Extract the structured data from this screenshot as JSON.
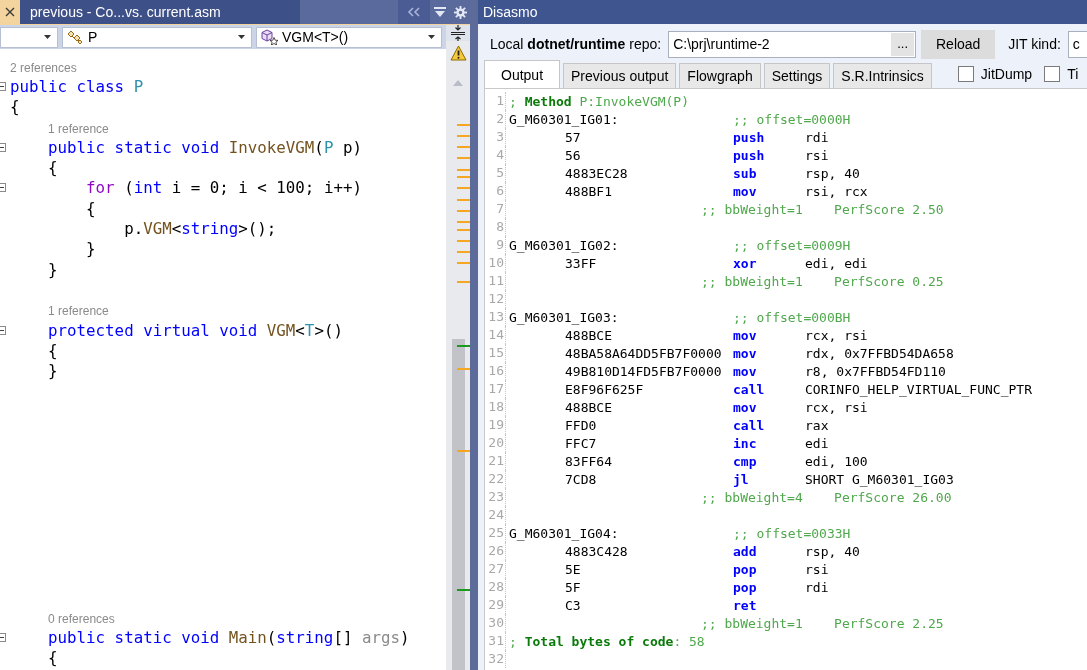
{
  "ide_tab": {
    "title": "previous - Co...vs. current.asm"
  },
  "navigation_bar": {
    "dropdowns": [
      {
        "kind": "empty"
      },
      {
        "kind": "class",
        "text": "P"
      },
      {
        "kind": "method",
        "text": "VGM<T>()"
      }
    ]
  },
  "editor": {
    "sections": [
      {
        "lines": [
          {
            "kind": "refs",
            "text": "2 references"
          },
          {
            "kind": "code",
            "fold": true,
            "tokens": [
              {
                "t": "public class ",
                "kind": "kw"
              },
              {
                "t": "P",
                "kind": "type"
              }
            ]
          },
          {
            "kind": "code",
            "fold": false,
            "tokens": [
              {
                "t": "{",
                "kind": "plain"
              }
            ]
          },
          {
            "kind": "refs",
            "text": "1 reference"
          },
          {
            "kind": "code",
            "fold": true,
            "tokens": [
              {
                "t": "    public static void ",
                "kind": "kw"
              },
              {
                "t": "InvokeVGM",
                "kind": "method"
              },
              {
                "t": "(",
                "kind": "plain"
              },
              {
                "t": "P",
                "kind": "type"
              },
              {
                "t": " p)",
                "kind": "plain"
              }
            ]
          },
          {
            "kind": "code",
            "fold": false,
            "tokens": [
              {
                "t": "    {",
                "kind": "plain"
              }
            ]
          },
          {
            "kind": "code",
            "fold": true,
            "tokens": [
              {
                "t": "        for",
                "kind": "ctrl"
              },
              {
                "t": " (",
                "kind": "plain"
              },
              {
                "t": "int",
                "kind": "kw"
              },
              {
                "t": " i = 0; i < 100; i++)",
                "kind": "plain"
              }
            ]
          },
          {
            "kind": "code",
            "fold": false,
            "tokens": [
              {
                "t": "        {",
                "kind": "plain"
              }
            ]
          },
          {
            "kind": "code",
            "fold": false,
            "tokens": [
              {
                "t": "            p.",
                "kind": "plain"
              },
              {
                "t": "VGM",
                "kind": "method"
              },
              {
                "t": "<",
                "kind": "plain"
              },
              {
                "t": "string",
                "kind": "kw"
              },
              {
                "t": ">();",
                "kind": "plain"
              }
            ]
          },
          {
            "kind": "code",
            "fold": false,
            "tokens": [
              {
                "t": "        }",
                "kind": "plain"
              }
            ]
          },
          {
            "kind": "code",
            "fold": false,
            "tokens": [
              {
                "t": "    }",
                "kind": "plain"
              }
            ]
          },
          {
            "kind": "blank"
          },
          {
            "kind": "refs",
            "text": "1 reference"
          },
          {
            "kind": "code",
            "fold": true,
            "tokens": [
              {
                "t": "    protected virtual void ",
                "kind": "kw"
              },
              {
                "t": "VGM",
                "kind": "method"
              },
              {
                "t": "<",
                "kind": "plain"
              },
              {
                "t": "T",
                "kind": "type"
              },
              {
                "t": ">()",
                "kind": "plain"
              }
            ]
          },
          {
            "kind": "code",
            "fold": false,
            "tokens": [
              {
                "t": "    {",
                "kind": "plain"
              }
            ]
          },
          {
            "kind": "code",
            "fold": false,
            "tokens": [
              {
                "t": "    }",
                "kind": "plain"
              }
            ]
          }
        ]
      },
      {
        "lines": [
          {
            "kind": "refs",
            "text": "0 references"
          },
          {
            "kind": "code",
            "fold": true,
            "tokens": [
              {
                "t": "    public static void ",
                "kind": "kw"
              },
              {
                "t": "Main",
                "kind": "method"
              },
              {
                "t": "(",
                "kind": "plain"
              },
              {
                "t": "string",
                "kind": "kw"
              },
              {
                "t": "[] ",
                "kind": "plain"
              },
              {
                "t": "args",
                "kind": "unused"
              },
              {
                "t": ")",
                "kind": "plain"
              }
            ]
          },
          {
            "kind": "code",
            "fold": false,
            "tokens": [
              {
                "t": "    {",
                "kind": "plain"
              }
            ]
          }
        ]
      }
    ]
  },
  "disasmo": {
    "title": "Disasmo",
    "repo_label": "Local **dotnet/runtime** repo:",
    "repo_path": "C:\\prj\\runtime-2",
    "browse_button": "...",
    "reload_button": "Reload",
    "jit_kind_label": "JIT kind:",
    "jit_kind_value": "c",
    "tabs": [
      {
        "label": "Output",
        "selected": true
      },
      {
        "label": "Previous output",
        "selected": false
      },
      {
        "label": "Flowgraph",
        "selected": false
      },
      {
        "label": "Settings",
        "selected": false
      },
      {
        "label": "S.R.Intrinsics",
        "selected": false
      }
    ],
    "checkboxes": [
      {
        "label": "JitDump",
        "checked": false
      },
      {
        "label": "Ti",
        "checked": false
      }
    ],
    "output_lines": [
      {
        "num": "1",
        "kind": "method",
        "text": "; **Method** P:InvokeVGM(P)"
      },
      {
        "num": "2",
        "kind": "label",
        "label": "G_M60301_IG01:",
        "comment": ";; offset=0000H"
      },
      {
        "num": "3",
        "kind": "instr",
        "bytes": "57",
        "op": "push",
        "args": "rdi"
      },
      {
        "num": "4",
        "kind": "instr",
        "bytes": "56",
        "op": "push",
        "args": "rsi"
      },
      {
        "num": "5",
        "kind": "instr",
        "bytes": "4883EC28",
        "op": "sub",
        "args": "rsp, 40"
      },
      {
        "num": "6",
        "kind": "instr",
        "bytes": "488BF1",
        "op": "mov",
        "args": "rsi, rcx"
      },
      {
        "num": "7",
        "kind": "weight",
        "comment": ";; bbWeight=1    PerfScore 2.50"
      },
      {
        "num": "8",
        "kind": "blank"
      },
      {
        "num": "9",
        "kind": "label",
        "label": "G_M60301_IG02:",
        "comment": ";; offset=0009H"
      },
      {
        "num": "10",
        "kind": "instr",
        "bytes": "33FF",
        "op": "xor",
        "args": "edi, edi"
      },
      {
        "num": "11",
        "kind": "weight",
        "comment": ";; bbWeight=1    PerfScore 0.25"
      },
      {
        "num": "12",
        "kind": "blank"
      },
      {
        "num": "13",
        "kind": "label",
        "label": "G_M60301_IG03:",
        "comment": ";; offset=000BH"
      },
      {
        "num": "14",
        "kind": "instr",
        "bytes": "488BCE",
        "op": "mov",
        "args": "rcx, rsi"
      },
      {
        "num": "15",
        "kind": "instr",
        "bytes": "48BA58A64DD5FB7F0000",
        "op": "mov",
        "args": "rdx, 0x7FFBD54DA658"
      },
      {
        "num": "16",
        "kind": "instr",
        "bytes": "49B810D14FD5FB7F0000",
        "op": "mov",
        "args": "r8, 0x7FFBD54FD110"
      },
      {
        "num": "17",
        "kind": "instr",
        "bytes": "E8F96F625F",
        "op": "call",
        "args": "CORINFO_HELP_VIRTUAL_FUNC_PTR"
      },
      {
        "num": "18",
        "kind": "instr",
        "bytes": "488BCE",
        "op": "mov",
        "args": "rcx, rsi"
      },
      {
        "num": "19",
        "kind": "instr",
        "bytes": "FFD0",
        "op": "call",
        "args": "rax"
      },
      {
        "num": "20",
        "kind": "instr",
        "bytes": "FFC7",
        "op": "inc",
        "args": "edi"
      },
      {
        "num": "21",
        "kind": "instr",
        "bytes": "83FF64",
        "op": "cmp",
        "args": "edi, 100"
      },
      {
        "num": "22",
        "kind": "instr",
        "bytes": "7CD8",
        "op": "jl",
        "args": "SHORT G_M60301_IG03"
      },
      {
        "num": "23",
        "kind": "weight",
        "comment": ";; bbWeight=4    PerfScore 26.00"
      },
      {
        "num": "24",
        "kind": "blank"
      },
      {
        "num": "25",
        "kind": "label",
        "label": "G_M60301_IG04:",
        "comment": ";; offset=0033H"
      },
      {
        "num": "26",
        "kind": "instr",
        "bytes": "4883C428",
        "op": "add",
        "args": "rsp, 40"
      },
      {
        "num": "27",
        "kind": "instr",
        "bytes": "5E",
        "op": "pop",
        "args": "rsi"
      },
      {
        "num": "28",
        "kind": "instr",
        "bytes": "5F",
        "op": "pop",
        "args": "rdi"
      },
      {
        "num": "29",
        "kind": "instr",
        "bytes": "C3",
        "op": "ret"
      },
      {
        "num": "30",
        "kind": "weight",
        "comment": ";; bbWeight=1    PerfScore 2.25"
      },
      {
        "num": "31",
        "kind": "method",
        "text": "; **Total bytes of code**: 58"
      },
      {
        "num": "32",
        "kind": "blank"
      }
    ]
  }
}
